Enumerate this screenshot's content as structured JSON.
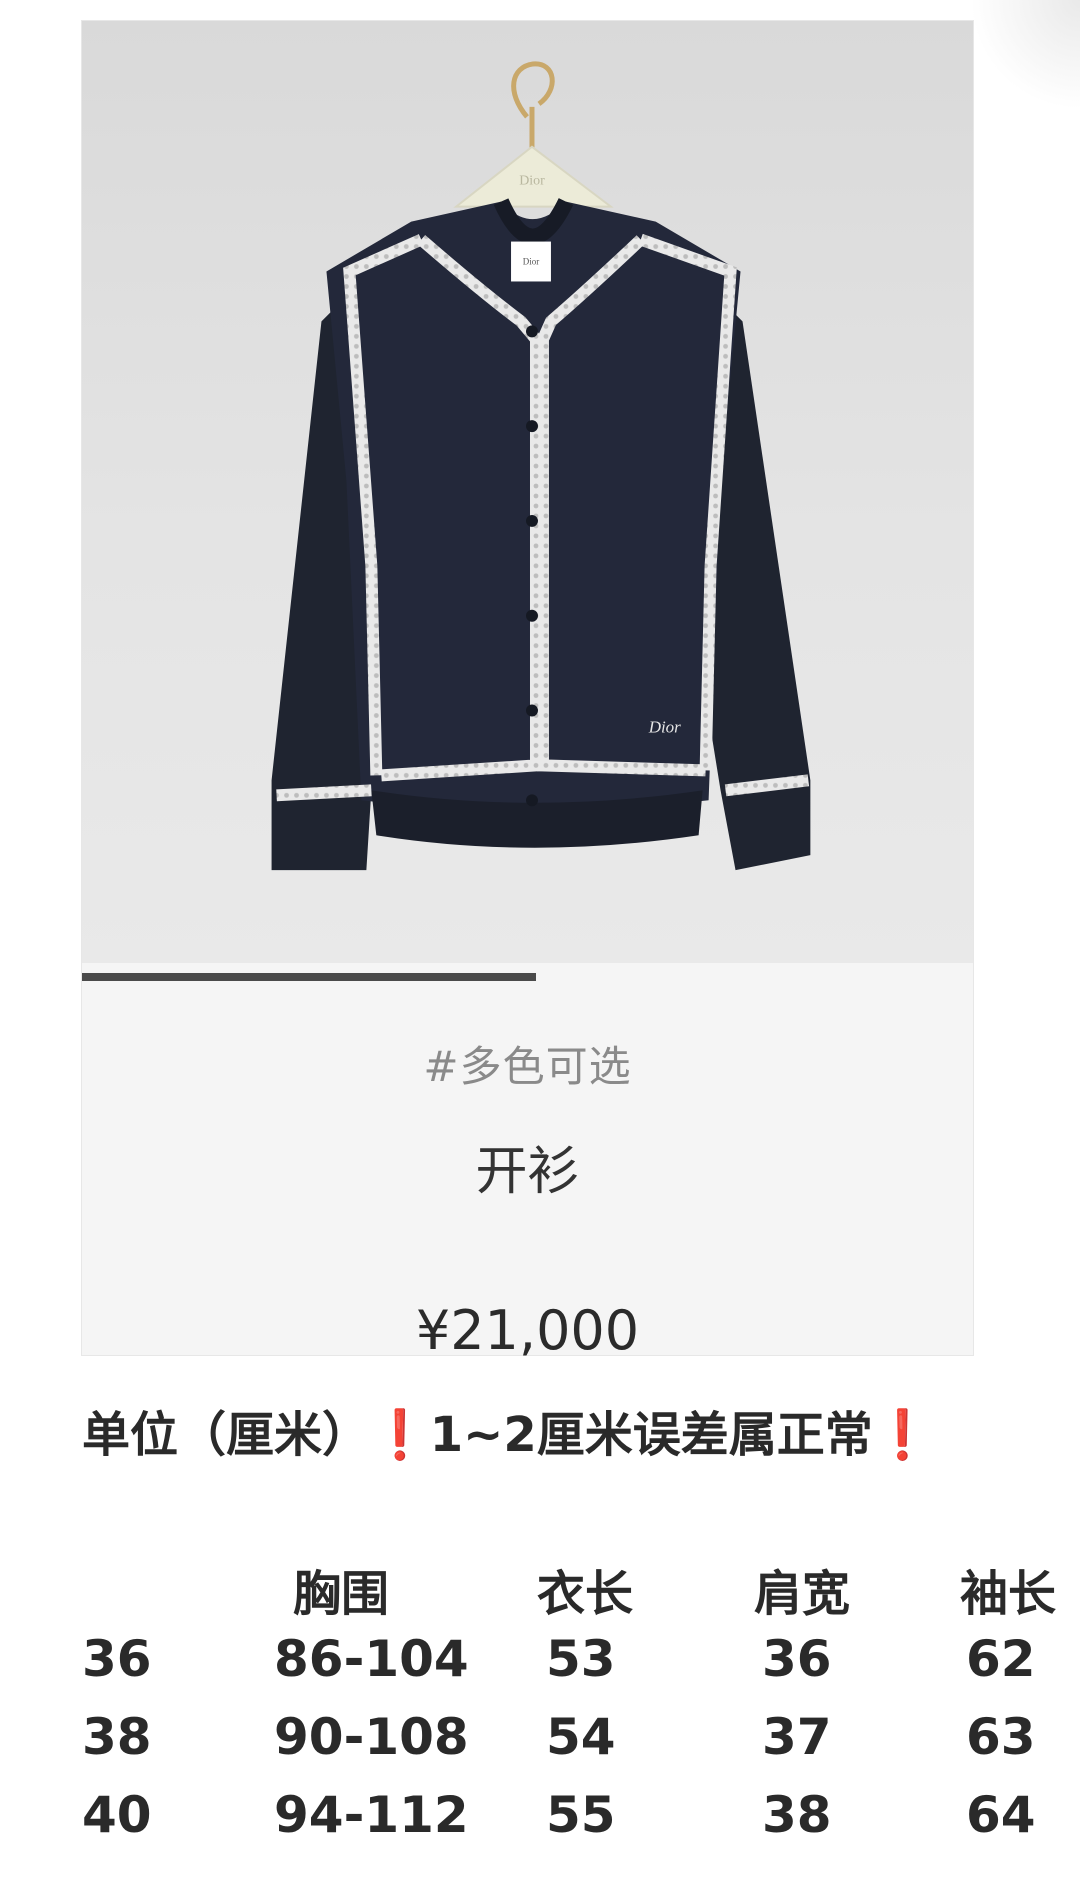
{
  "product": {
    "tag": "#多色可选",
    "title": "开衫",
    "price": "¥21,000",
    "brand_marks": [
      "Dior",
      "Dior",
      "Dior"
    ],
    "carousel_progress": 0.51
  },
  "note": {
    "prefix": "单位（厘米）",
    "bang_left": "❗",
    "middle": "1~2厘米误差属正常",
    "bang_right": "❗"
  },
  "size_table": {
    "headers": [
      "胸围",
      "衣长",
      "肩宽",
      "袖长"
    ],
    "rows": [
      {
        "size": "36",
        "chest": "86-104",
        "length": "53",
        "shoulder": "36",
        "sleeve": "62"
      },
      {
        "size": "38",
        "chest": "90-108",
        "length": "54",
        "shoulder": "37",
        "sleeve": "63"
      },
      {
        "size": "40",
        "chest": "94-112",
        "length": "55",
        "shoulder": "38",
        "sleeve": "64"
      }
    ]
  },
  "colors": {
    "garment": "#1f2430",
    "lace_trim": "#e8e8e8",
    "alert": "#e02a2a",
    "progress": "#4a4a4a"
  }
}
